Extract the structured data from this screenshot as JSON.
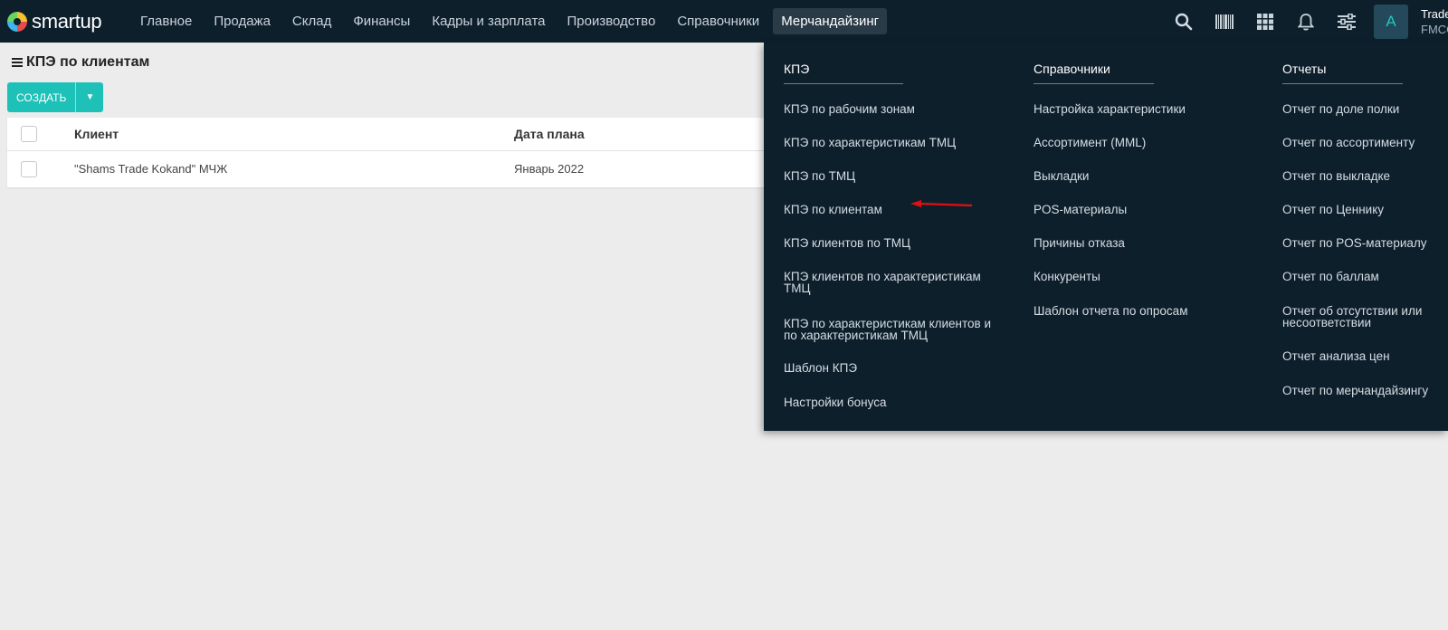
{
  "brand": {
    "name": "smartup"
  },
  "nav": [
    {
      "label": "Главное"
    },
    {
      "label": "Продажа"
    },
    {
      "label": "Склад"
    },
    {
      "label": "Финансы"
    },
    {
      "label": "Кадры и зарплата"
    },
    {
      "label": "Производство"
    },
    {
      "label": "Справочники"
    },
    {
      "label": "Мерчандайзинг",
      "active": true
    }
  ],
  "tools": [
    "search-icon",
    "barcode-icon",
    "apps-grid-icon",
    "bell-icon",
    "sliders-icon"
  ],
  "user": {
    "avatar_letter": "A",
    "name": "Trade",
    "subtitle": "FMCG"
  },
  "page": {
    "title": "КПЭ по клиентам",
    "create_label": "СОЗДАТЬ",
    "table": {
      "columns": [
        "Клиент",
        "Дата плана"
      ],
      "rows": [
        {
          "client": "\"Shams Trade Kokand\" МЧЖ",
          "date": "Январь 2022"
        }
      ]
    }
  },
  "menu": {
    "columns": [
      {
        "title": "КПЭ",
        "items": [
          "КПЭ по рабочим зонам",
          "КПЭ по характеристикам ТМЦ",
          "КПЭ по ТМЦ",
          "КПЭ по клиентам",
          "КПЭ клиентов по ТМЦ",
          [
            "КПЭ клиентов по характеристикам",
            "ТМЦ"
          ],
          [
            "КПЭ по характеристикам клиентов и",
            "по характеристикам ТМЦ"
          ],
          "Шаблон КПЭ",
          "Настройки бонуса"
        ]
      },
      {
        "title": "Справочники",
        "items": [
          "Настройка характеристики",
          "Ассортимент (MML)",
          "Выкладки",
          "POS-материалы",
          "Причины отказа",
          "Конкуренты",
          "Шаблон отчета по опросам"
        ]
      },
      {
        "title": "Отчеты",
        "items": [
          "Отчет по доле полки",
          "Отчет по ассортименту",
          "Отчет по выкладке",
          "Отчет по Ценнику",
          "Отчет по POS-материалу",
          "Отчет по баллам",
          [
            "Отчет об отсутствии или",
            "несоответствии"
          ],
          "Отчет анализа цен",
          "Отчет по мерчандайзингу"
        ]
      }
    ]
  },
  "colors": {
    "topbar": "#0e1f2c",
    "accent": "#1ec1b8",
    "annotation_arrow": "#e01010"
  }
}
